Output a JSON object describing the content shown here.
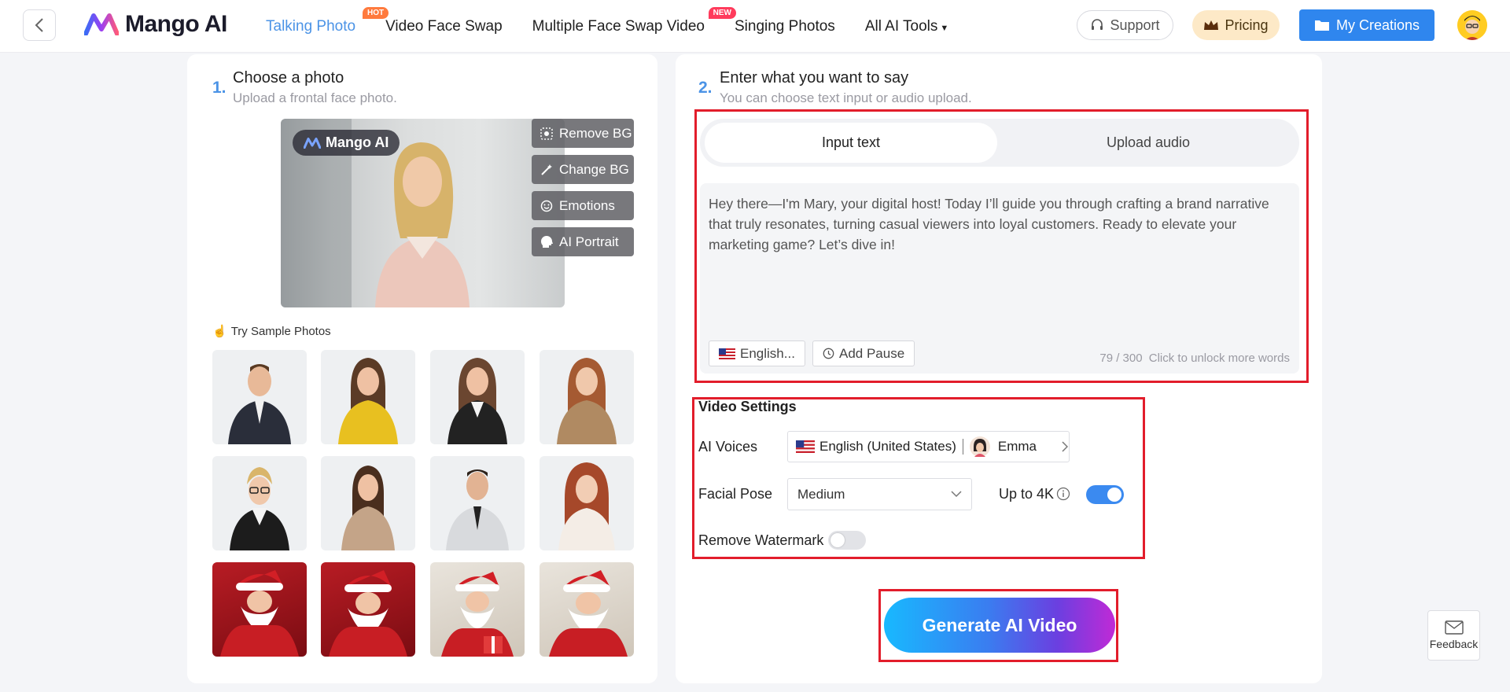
{
  "header": {
    "logo_text": "Mango AI",
    "nav": [
      {
        "label": "Talking Photo",
        "badge": "HOT"
      },
      {
        "label": "Video Face Swap",
        "badge": ""
      },
      {
        "label": "Multiple Face Swap Video",
        "badge": "NEW"
      },
      {
        "label": "Singing Photos",
        "badge": ""
      },
      {
        "label": "All AI Tools",
        "badge": ""
      }
    ],
    "support_label": "Support",
    "pricing_label": "Pricing",
    "creations_label": "My Creations"
  },
  "step1": {
    "number": "1.",
    "title": "Choose a photo",
    "subtitle": "Upload a frontal face photo.",
    "photo_badge": "Mango AI",
    "tools": [
      "Remove BG",
      "Change BG",
      "Emotions",
      "AI Portrait"
    ],
    "samples_label": "Try Sample Photos"
  },
  "step2": {
    "number": "2.",
    "title": "Enter what you want to say",
    "subtitle": "You can choose text input or audio upload.",
    "tabs": [
      "Input text",
      "Upload audio"
    ],
    "text": "Hey there—I'm Mary, your digital host! Today I’ll guide you through crafting a brand narrative that truly resonates, turning casual viewers into loyal customers. Ready to elevate your marketing game? Let’s dive in!",
    "language_label": "English...",
    "pause_label": "Add Pause",
    "word_count": "79 / 300",
    "unlock_text": "Click to unlock more words"
  },
  "settings": {
    "title": "Video Settings",
    "voices_label": "AI Voices",
    "voice_language": "English (United States)",
    "voice_name": "Emma",
    "pose_label": "Facial Pose",
    "pose_value": "Medium",
    "hd_label": "Up to 4K",
    "hd_enabled": true,
    "watermark_label": "Remove Watermark",
    "watermark_enabled": false
  },
  "generate_label": "Generate AI Video",
  "feedback_label": "Feedback",
  "colors": {
    "accent": "#4b93e6",
    "primary_button": "#2f86ee",
    "highlight_box": "#e21d2b",
    "toggle_on": "#3b8af0"
  }
}
